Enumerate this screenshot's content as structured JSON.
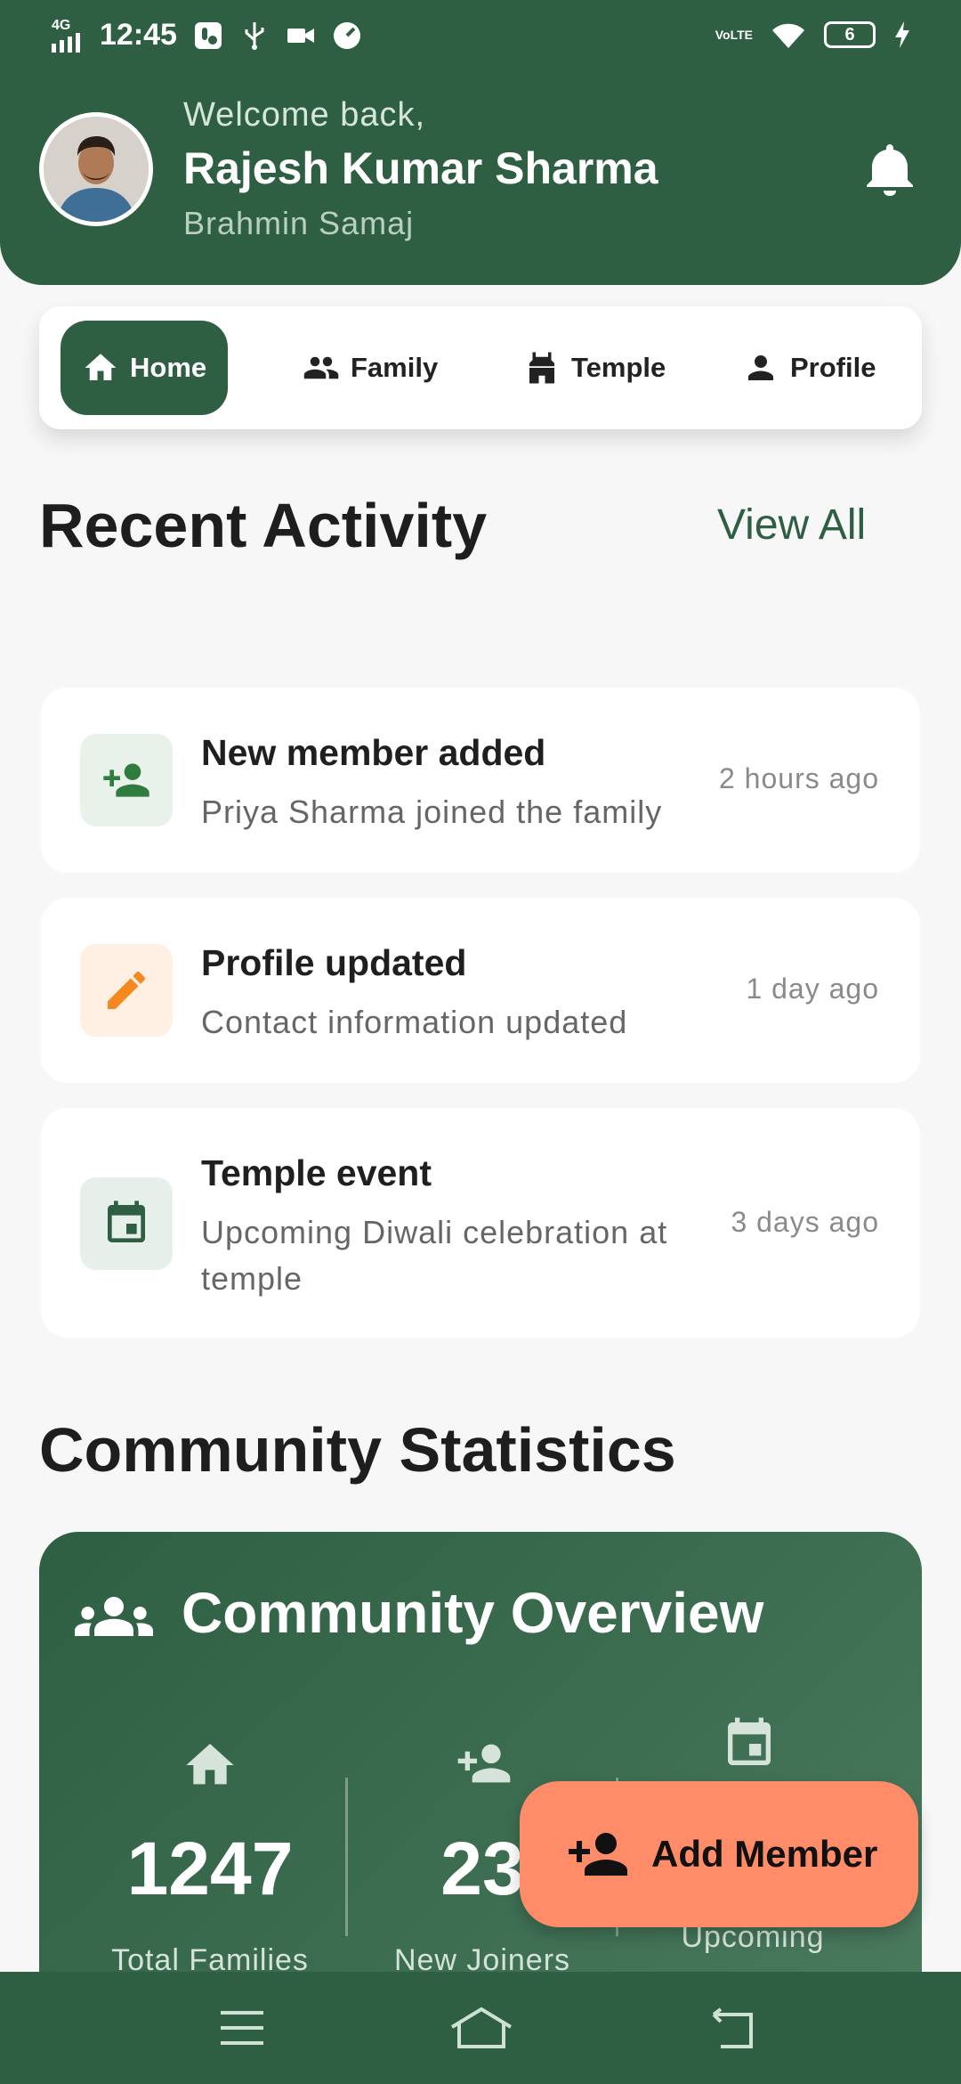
{
  "status_bar": {
    "network": "4G",
    "time": "12:45",
    "volte": "VoLTE",
    "battery": "6"
  },
  "header": {
    "welcome": "Welcome back,",
    "name": "Rajesh Kumar Sharma",
    "community": "Brahmin Samaj"
  },
  "nav_tabs": [
    {
      "label": "Home",
      "icon": "home-icon",
      "active": true
    },
    {
      "label": "Family",
      "icon": "group-icon",
      "active": false
    },
    {
      "label": "Temple",
      "icon": "temple-icon",
      "active": false
    },
    {
      "label": "Profile",
      "icon": "person-icon",
      "active": false
    }
  ],
  "recent_activity": {
    "title": "Recent Activity",
    "view_all": "View All",
    "items": [
      {
        "title": "New member added",
        "description": "Priya Sharma joined the family",
        "time": "2 hours ago",
        "icon": "person-add-icon"
      },
      {
        "title": "Profile updated",
        "description": "Contact information updated",
        "time": "1 day ago",
        "icon": "edit-icon"
      },
      {
        "title": "Temple event",
        "description": "Upcoming Diwali celebration at temple",
        "time": "3 days ago",
        "icon": "calendar-icon"
      }
    ]
  },
  "community_statistics": {
    "title": "Community Statistics",
    "overview_title": "Community Overview",
    "stats": [
      {
        "value": "1247",
        "label": "Total Families",
        "icon": "home-icon"
      },
      {
        "value": "23",
        "label": "New Joiners",
        "icon": "person-add-icon"
      },
      {
        "value": "",
        "label": "Upcoming",
        "icon": "calendar-icon"
      }
    ]
  },
  "fab": {
    "label": "Add Member",
    "icon": "person-add-icon"
  },
  "colors": {
    "primary": "#2e5f43",
    "accent": "#ff8c69",
    "background": "#f7f7f7"
  }
}
